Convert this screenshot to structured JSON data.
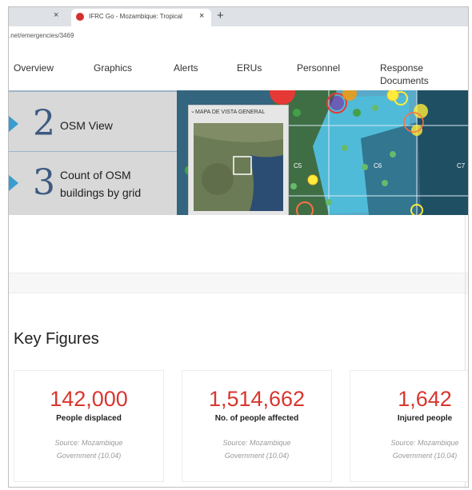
{
  "browser": {
    "active_tab_title": "IFRC Go - Mozambique: Tropical",
    "url": ".net/emergencies/3469",
    "new_tab_symbol": "+",
    "close_symbol": "×"
  },
  "nav": {
    "items": [
      {
        "label": "Overview"
      },
      {
        "label": "Graphics"
      },
      {
        "label": "Alerts"
      },
      {
        "label": "ERUs"
      },
      {
        "label": "Personnel"
      },
      {
        "label_line1": "Response",
        "label_line2": "Documents"
      }
    ]
  },
  "banner": {
    "steps": [
      {
        "number": "2",
        "label_line1": "OSM View",
        "label_line2": ""
      },
      {
        "number": "3",
        "label_line1": "Count of OSM",
        "label_line2": "buildings by grid"
      }
    ],
    "map": {
      "inset_title": "MAPA DE VISTA GENERAL",
      "grid_labels": [
        "C5",
        "C6",
        "C7"
      ]
    }
  },
  "key_figures": {
    "title": "Key Figures",
    "cards": [
      {
        "value": "142,000",
        "label": "People displaced",
        "source_line1": "Source: Mozambique",
        "source_line2": "Government (10.04)"
      },
      {
        "value": "1,514,662",
        "label": "No. of people affected",
        "source_line1": "Source: Mozambique",
        "source_line2": "Government (10.04)"
      },
      {
        "value": "1,642",
        "label": "Injured people",
        "source_line1": "Source: Mozambique",
        "source_line2": "Government (10.04)"
      }
    ]
  },
  "colors": {
    "accent_red": "#d8362f",
    "step_arrow": "#3b9ccf",
    "step_number": "#3d5a80"
  }
}
